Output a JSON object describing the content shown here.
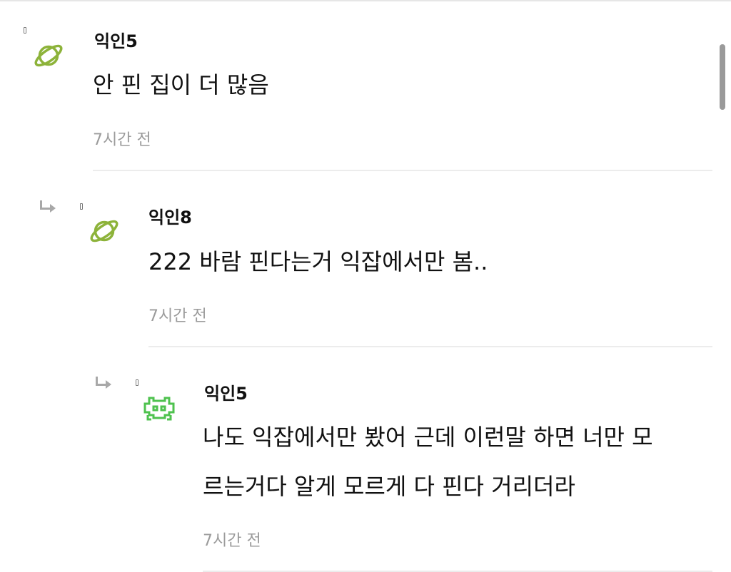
{
  "comments": [
    {
      "author": "익인5",
      "avatar_icon": "planet-icon",
      "avatar_color": "#8db33a",
      "lines": [
        "안 핀 집이 더 많음"
      ],
      "time": "7시간 전",
      "is_reply": false
    },
    {
      "author": "익인8",
      "avatar_icon": "planet-icon",
      "avatar_color": "#8db33a",
      "lines": [
        "222 바람 핀다는거 익잡에서만 봄.."
      ],
      "time": "7시간 전",
      "is_reply": true
    },
    {
      "author": "익인5",
      "avatar_icon": "space-invader-icon",
      "avatar_color": "#4ec24e",
      "lines": [
        "나도 익잡에서만 봤어 근데 이런말 하면 너만 모",
        "르는거다 알게 모르게 다 핀다 거리더라"
      ],
      "time": "7시간 전",
      "is_reply": true
    }
  ],
  "colors": {
    "text": "#111111",
    "muted": "#9b9b9b",
    "divider": "#ececec",
    "reply_arrow": "#a8a8a8",
    "scrollbar": "#9a9a9a"
  }
}
